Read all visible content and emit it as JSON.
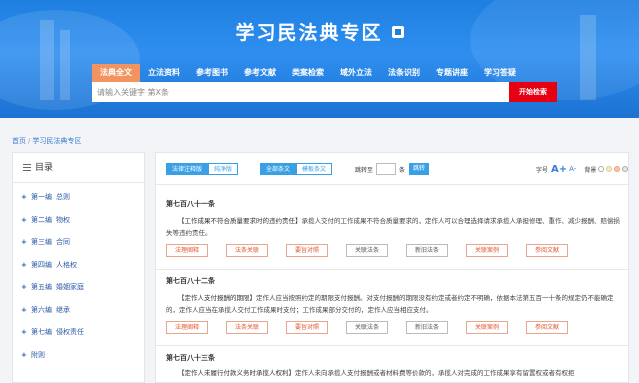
{
  "header": {
    "title": "学习民法典专区",
    "nav": [
      "法典全文",
      "立法资料",
      "参考图书",
      "参考文献",
      "类案检索",
      "域外立法",
      "法条识别",
      "专题讲座",
      "学习答疑"
    ],
    "search_placeholder": "请输入关键字 第X条",
    "search_button": "开始检索"
  },
  "breadcrumb": [
    "首页",
    "学习民法典专区"
  ],
  "sidebar": {
    "heading": "目录",
    "items": [
      {
        "part": "第一编",
        "name": "总则"
      },
      {
        "part": "第二编",
        "name": "物权"
      },
      {
        "part": "第三编",
        "name": "合同"
      },
      {
        "part": "第四编",
        "name": "人格权"
      },
      {
        "part": "第五编",
        "name": "婚姻家庭"
      },
      {
        "part": "第六编",
        "name": "继承"
      },
      {
        "part": "第七编",
        "name": "侵权责任"
      },
      {
        "part": "附则",
        "name": ""
      }
    ]
  },
  "toolbar": {
    "toggle_annot": [
      "法律注释版",
      "纯净版"
    ],
    "toggle_text": [
      "全部条文",
      "模板条文"
    ],
    "jump_label": "跳转至",
    "jump_suffix": "条",
    "jump_button": "跳转",
    "font_label": "字号",
    "font_big": "A+",
    "font_small": "A-",
    "bg_label": "背景"
  },
  "articles": [
    {
      "title": "第七百八十一条",
      "body_head": "【工作成果不符合质量要求时的违约责任】",
      "body": "承揽人交付的工作成果不符合质量要求的，定作人可以合理选择请求承揽人承担修理、重作、减少报酬、赔偿损失等违约责任。"
    },
    {
      "title": "第七百八十二条",
      "body_head": "【定作人支付报酬的期限】",
      "body": "定作人应当按照约定的期限支付报酬。对支付报酬的期限没有约定或者约定不明确，依据本法第五百一十条的规定仍不能确定的，定作人应当在承揽人交付工作成果时支付；工作成果部分交付的，定作人应当相应支付。"
    },
    {
      "title": "第七百八十三条",
      "body_head": "【定作人未履行付款义务时承揽人权利】",
      "body": "定作人未向承揽人支付报酬或者材料费等价款的，承揽人对完成的工作成果享有留置权或者有权拒"
    }
  ],
  "article_actions": [
    "法理阐释",
    "法条关联",
    "要旨对照",
    "关联法条",
    "新旧法条",
    "关联案例",
    "参阅文献"
  ],
  "colors": {
    "banner": "#1e7fe0",
    "nav_active": "#f29360",
    "search_button": "#e60012",
    "toggle": "#3aa0e6",
    "action_red": "#e2532d"
  }
}
